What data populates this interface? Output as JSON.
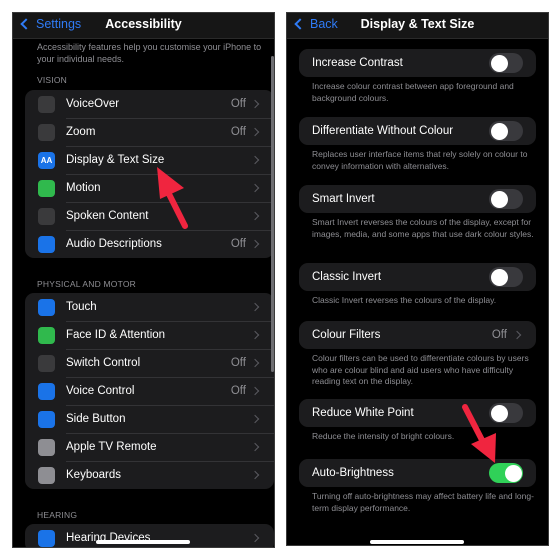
{
  "left": {
    "nav": {
      "back_label": "Settings",
      "title": "Accessibility"
    },
    "intro": "Accessibility features help you customise your iPhone to your individual needs.",
    "sections": {
      "vision": {
        "header": "VISION",
        "items": [
          {
            "label": "VoiceOver",
            "value": "Off",
            "icon": "voiceover-icon",
            "color": "#3a3a3c"
          },
          {
            "label": "Zoom",
            "value": "Off",
            "icon": "zoom-icon",
            "color": "#3a3a3c"
          },
          {
            "label": "Display & Text Size",
            "value": "",
            "icon": "text-size-icon",
            "color": "#1a73e8",
            "glyph": "AA"
          },
          {
            "label": "Motion",
            "value": "",
            "icon": "motion-icon",
            "color": "#30b94d"
          },
          {
            "label": "Spoken Content",
            "value": "",
            "icon": "speech-bubble-icon",
            "color": "#3a3a3c"
          },
          {
            "label": "Audio Descriptions",
            "value": "Off",
            "icon": "audio-description-icon",
            "color": "#1a73e8"
          }
        ]
      },
      "physical": {
        "header": "PHYSICAL AND MOTOR",
        "items": [
          {
            "label": "Touch",
            "value": "",
            "icon": "hand-touch-icon",
            "color": "#1a73e8"
          },
          {
            "label": "Face ID & Attention",
            "value": "",
            "icon": "face-id-icon",
            "color": "#30b94d"
          },
          {
            "label": "Switch Control",
            "value": "Off",
            "icon": "switch-control-icon",
            "color": "#3a3a3c"
          },
          {
            "label": "Voice Control",
            "value": "Off",
            "icon": "voice-control-icon",
            "color": "#1a73e8"
          },
          {
            "label": "Side Button",
            "value": "",
            "icon": "side-button-icon",
            "color": "#1a73e8"
          },
          {
            "label": "Apple TV Remote",
            "value": "",
            "icon": "tv-remote-icon",
            "color": "#8e8e93"
          },
          {
            "label": "Keyboards",
            "value": "",
            "icon": "keyboard-icon",
            "color": "#8e8e93"
          }
        ]
      },
      "hearing": {
        "header": "HEARING",
        "items": [
          {
            "label": "Hearing Devices",
            "value": "",
            "icon": "ear-icon",
            "color": "#1a73e8"
          }
        ]
      }
    }
  },
  "right": {
    "nav": {
      "back_label": "Back",
      "title": "Display & Text Size"
    },
    "settings": [
      {
        "label": "Increase Contrast",
        "type": "toggle",
        "on": false,
        "footnote": "Increase colour contrast between app foreground and background colours."
      },
      {
        "label": "Differentiate Without Colour",
        "type": "toggle",
        "on": false,
        "footnote": "Replaces user interface items that rely solely on colour to convey information with alternatives."
      },
      {
        "label": "Smart Invert",
        "type": "toggle",
        "on": false,
        "footnote": "Smart Invert reverses the colours of the display, except for images, media, and some apps that use dark colour styles."
      },
      {
        "label": "Classic Invert",
        "type": "toggle",
        "on": false,
        "footnote": "Classic Invert reverses the colours of the display."
      },
      {
        "label": "Colour Filters",
        "type": "link",
        "value": "Off",
        "footnote": "Colour filters can be used to differentiate colours by users who are colour blind and aid users who have difficulty reading text on the display."
      },
      {
        "label": "Reduce White Point",
        "type": "toggle",
        "on": false,
        "footnote": "Reduce the intensity of bright colours."
      },
      {
        "label": "Auto-Brightness",
        "type": "toggle",
        "on": true,
        "footnote": "Turning off auto-brightness may affect battery life and long-term display performance."
      }
    ]
  },
  "colors": {
    "accent": "#2f7bf6",
    "toggle_on": "#30d158",
    "annotation_arrow": "#f0253f"
  }
}
